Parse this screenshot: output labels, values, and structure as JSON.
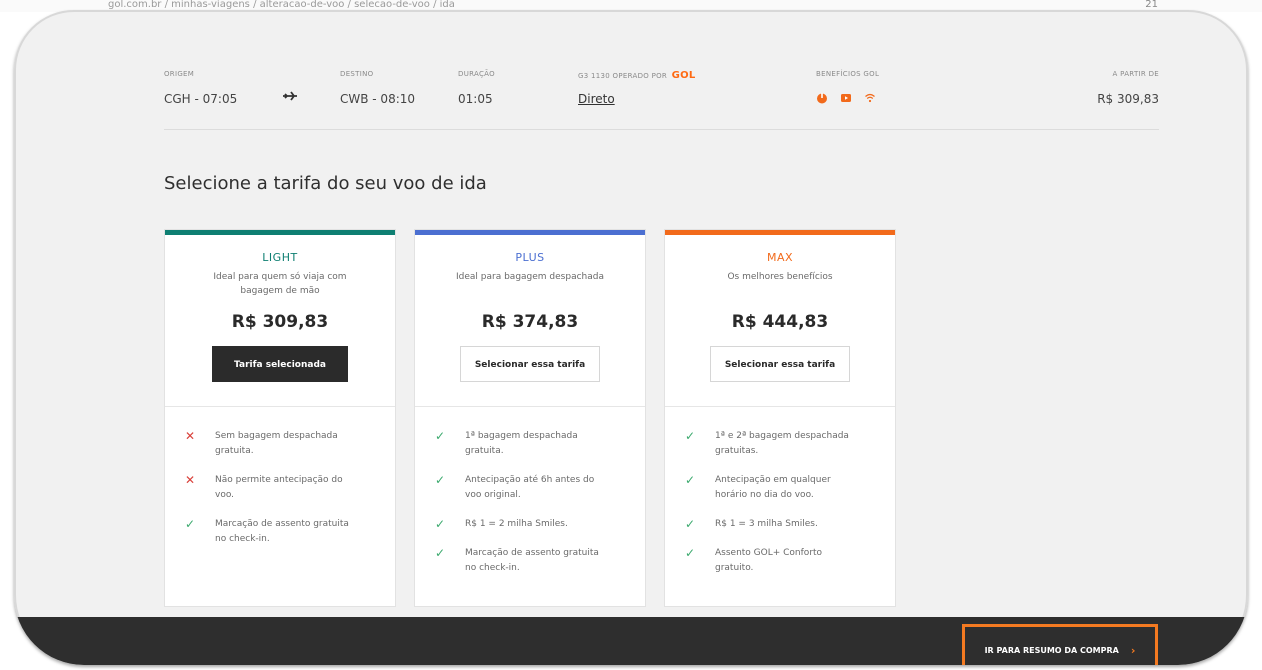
{
  "browser": {
    "url_fragment": "gol.com.br / minhas-viagens / alteracao-de-voo / selecao-de-voo / ida",
    "corner": "21"
  },
  "flight": {
    "origin_label": "ORIGEM",
    "origin_value": "CGH - 07:05",
    "destination_label": "DESTINO",
    "destination_value": "CWB - 08:10",
    "duration_label": "DURAÇÃO",
    "duration_value": "01:05",
    "operated_label": "G3 1130 OPERADO POR",
    "operator_logo": "GOL",
    "stop_value": "Direto",
    "benefits_label": "BENEFÍCIOS GOL",
    "benefit_icons": [
      "power-icon",
      "entertainment-icon",
      "wifi-icon"
    ],
    "price_from_label": "A PARTIR DE",
    "price_from_value": "R$ 309,83"
  },
  "section_title": "Selecione a tarifa do seu voo de ida",
  "fares": [
    {
      "name": "LIGHT",
      "color": "#0e7f72",
      "description": "Ideal para quem só viaja com bagagem de mão",
      "price": "R$ 309,83",
      "button": "Tarifa selecionada",
      "features": [
        {
          "type": "x",
          "text": "Sem bagagem despachada gratuita."
        },
        {
          "type": "ok",
          "text": "Não permite antecipação do voo."
        },
        {
          "type": "ok",
          "text": "Marcação de assento gratuita no check-in."
        }
      ]
    },
    {
      "name": "PLUS",
      "color": "#4b6fd1",
      "description": "Ideal para bagagem despachada",
      "price": "R$ 374,83",
      "button": "Selecionar essa tarifa",
      "features": [
        {
          "type": "ok",
          "text": "1ª bagagem despachada gratuita."
        },
        {
          "type": "ok",
          "text": "Antecipação até 6h antes do voo original."
        },
        {
          "type": "ok",
          "text": "R$ 1 = 2 milha Smiles."
        },
        {
          "type": "ok",
          "text": "Marcação de assento gratuita no check-in."
        }
      ]
    },
    {
      "name": "MAX",
      "color": "#f26a1b",
      "description": "Os melhores benefícios",
      "price": "R$ 444,83",
      "button": "Selecionar essa tarifa",
      "features": [
        {
          "type": "ok",
          "text": "1ª e 2ª bagagem despachada gratuitas."
        },
        {
          "type": "ok",
          "text": "Antecipação em qualquer horário no dia do voo."
        },
        {
          "type": "ok",
          "text": "R$ 1 = 3 milha Smiles."
        },
        {
          "type": "ok",
          "text": "Assento GOL+ Conforto gratuito."
        }
      ]
    }
  ],
  "cta": {
    "label": "IR PARA RESUMO DA COMPRA",
    "chevron": "›",
    "highlight_color": "#f47a21"
  }
}
